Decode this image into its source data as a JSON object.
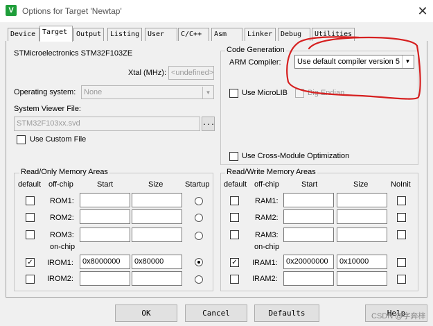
{
  "window": {
    "title": "Options for Target 'Newtap'",
    "close_glyph": "✕",
    "app_icon_letter": "V"
  },
  "tabs": [
    "Device",
    "Target",
    "Output",
    "Listing",
    "User",
    "C/C++",
    "Asm",
    "Linker",
    "Debug",
    "Utilities"
  ],
  "active_tab": "Target",
  "device": {
    "name": "STMicroelectronics STM32F103ZE",
    "xtal_label": "Xtal (MHz):",
    "xtal_value": "<undefined>",
    "os_label": "Operating system:",
    "os_value": "None",
    "svf_label": "System Viewer File:",
    "svf_value": "STM32F103xx.svd",
    "browse_label": "...",
    "custom_file_label": "Use Custom File",
    "custom_file_checked": false
  },
  "code_gen": {
    "legend": "Code Generation",
    "compiler_label": "ARM Compiler:",
    "compiler_value": "Use default compiler version 5",
    "microlib_label": "Use MicroLIB",
    "microlib_checked": false,
    "big_endian_label": "Big Endian",
    "cross_module_label": "Use Cross-Module Optimization",
    "cross_module_checked": false
  },
  "ro_memory": {
    "legend": "Read/Only Memory Areas",
    "headers": {
      "default": "default",
      "offchip": "off-chip",
      "start": "Start",
      "size": "Size",
      "last": "Startup"
    },
    "onchip_label": "on-chip",
    "rows": [
      {
        "name": "ROM1:",
        "start": "",
        "size": "",
        "default": false,
        "selected": false
      },
      {
        "name": "ROM2:",
        "start": "",
        "size": "",
        "default": false,
        "selected": false
      },
      {
        "name": "ROM3:",
        "start": "",
        "size": "",
        "default": false,
        "selected": false
      },
      {
        "name": "IROM1:",
        "start": "0x8000000",
        "size": "0x80000",
        "default": true,
        "selected": true
      },
      {
        "name": "IROM2:",
        "start": "",
        "size": "",
        "default": false,
        "selected": false
      }
    ]
  },
  "rw_memory": {
    "legend": "Read/Write Memory Areas",
    "headers": {
      "default": "default",
      "offchip": "off-chip",
      "start": "Start",
      "size": "Size",
      "last": "NoInit"
    },
    "onchip_label": "on-chip",
    "rows": [
      {
        "name": "RAM1:",
        "start": "",
        "size": "",
        "default": false,
        "noinit": false
      },
      {
        "name": "RAM2:",
        "start": "",
        "size": "",
        "default": false,
        "noinit": false
      },
      {
        "name": "RAM3:",
        "start": "",
        "size": "",
        "default": false,
        "noinit": false
      },
      {
        "name": "IRAM1:",
        "start": "0x20000000",
        "size": "0x10000",
        "default": true,
        "noinit": false
      },
      {
        "name": "IRAM2:",
        "start": "",
        "size": "",
        "default": false,
        "noinit": false
      }
    ]
  },
  "buttons": {
    "ok": "OK",
    "cancel": "Cancel",
    "defaults": "Defaults",
    "help": "Help"
  },
  "watermark": "CSDN @字奔梓",
  "colors": {
    "annotation": "#d62020",
    "checkbox_on_mark": "✓"
  }
}
